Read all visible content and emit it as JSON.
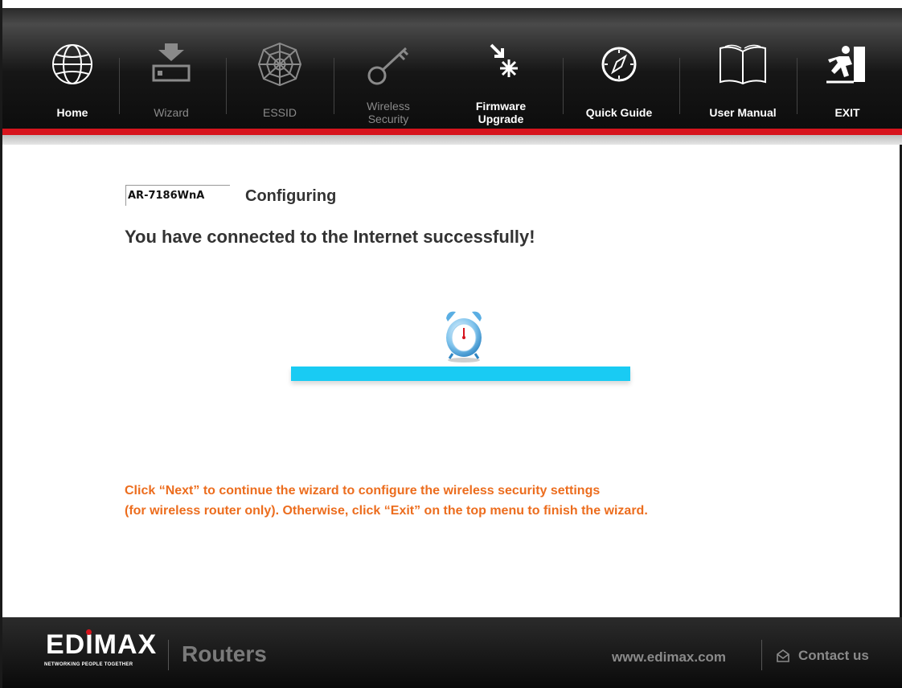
{
  "nav": {
    "home": "Home",
    "wizard": "Wizard",
    "essid": "ESSID",
    "wireless_security_1": "Wireless",
    "wireless_security_2": "Security",
    "firmware_1": "Firmware",
    "firmware_2": "Upgrade",
    "quick_guide": "Quick Guide",
    "user_manual": "User Manual",
    "exit": "EXIT"
  },
  "content": {
    "model": "AR-7186WnA",
    "status": "Configuring",
    "message": "You have connected to the Internet successfully!",
    "progress_fraction": 1.0,
    "instruction_line1": "Click “Next” to continue the wizard to configure the wireless security settings",
    "instruction_line2": "(for wireless router only). Otherwise, click “Exit” on the top menu to finish the wizard."
  },
  "footer": {
    "brand": "EDIMAX",
    "tagline": "NETWORKING PEOPLE TOGETHER",
    "product": "Routers",
    "website": "www.edimax.com",
    "contact": "Contact us"
  },
  "colors": {
    "accent_red": "#d6141d",
    "progress_blue": "#19cbf3",
    "instruction_orange": "#ec6d1e"
  },
  "icons": [
    "globe-icon",
    "wizard-icon",
    "web-icon",
    "key-icon",
    "firmware-icon",
    "compass-icon",
    "book-icon",
    "exit-icon",
    "alarm-clock-icon",
    "envelope-icon"
  ]
}
